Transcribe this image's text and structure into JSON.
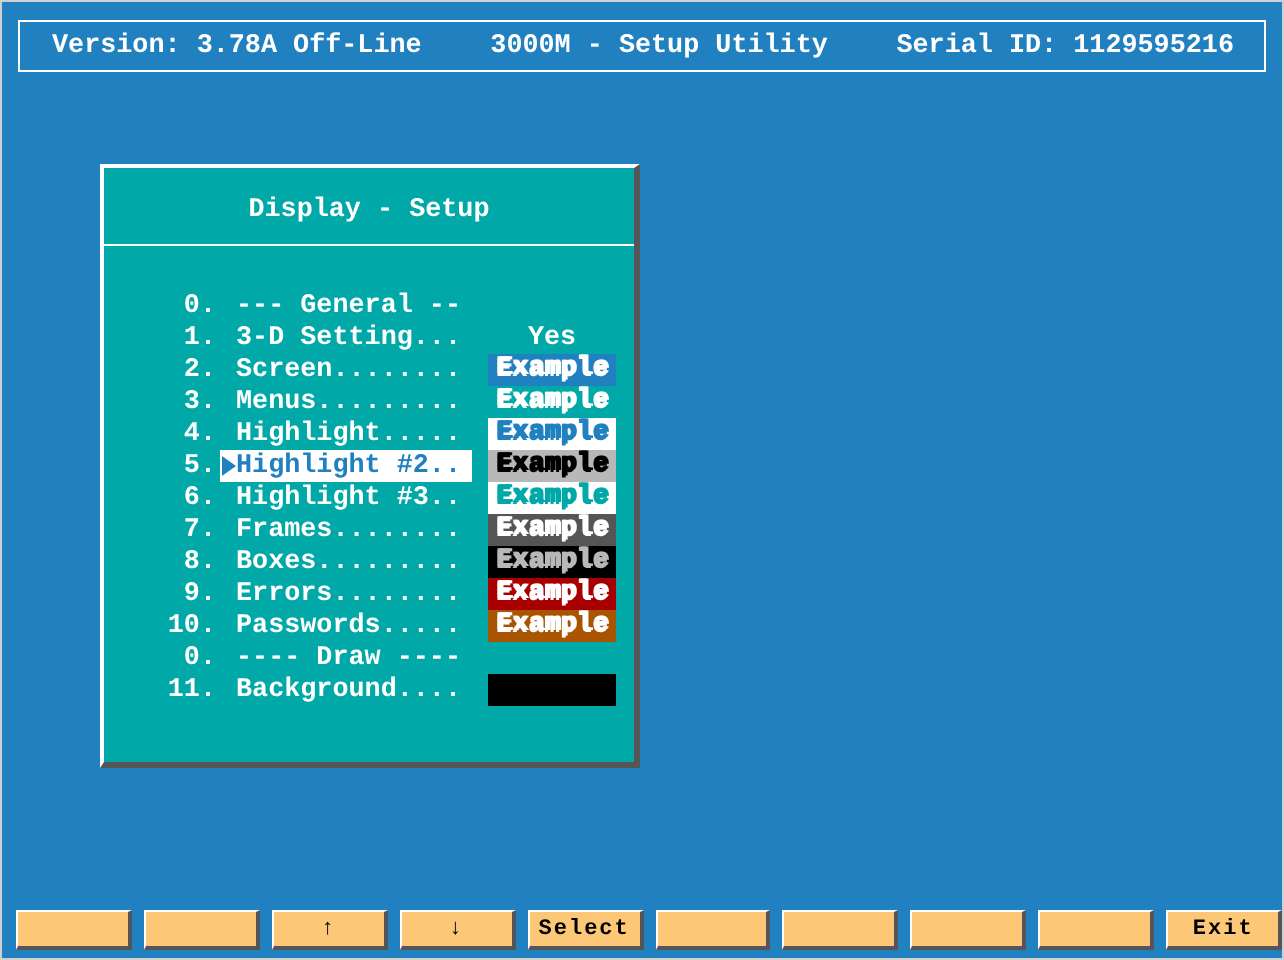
{
  "header": {
    "version": "Version: 3.78A Off-Line",
    "title": "3000M - Setup Utility",
    "serial": "Serial ID: 1129595216"
  },
  "dialog": {
    "title": "Display - Setup",
    "items": [
      {
        "number": "0.",
        "label": "--- General --",
        "kind": "heading",
        "selected": false
      },
      {
        "number": "1.",
        "label": "3-D Setting...",
        "kind": "value",
        "value": "Yes",
        "selected": false
      },
      {
        "number": "2.",
        "label": "Screen........",
        "kind": "example",
        "value": "Example",
        "color": "#2080c0",
        "ink": {
          "color": "#ffffff"
        },
        "selected": false
      },
      {
        "number": "3.",
        "label": "Menus.........",
        "kind": "example",
        "value": "Example",
        "color": "#00a8a8",
        "ink": {
          "color": "#ffffff"
        },
        "selected": false
      },
      {
        "number": "4.",
        "label": "Highlight.....",
        "kind": "example",
        "value": "Example",
        "color": "#ffffff",
        "ink": {
          "color": "#2080c0"
        },
        "selected": false
      },
      {
        "number": "5.",
        "label": "Highlight #2..",
        "kind": "example",
        "value": "Example",
        "color": "#b8b8b8",
        "ink": {
          "color": "#000000"
        },
        "selected": true
      },
      {
        "number": "6.",
        "label": "Highlight #3..",
        "kind": "example",
        "value": "Example",
        "color": "#ffffff",
        "ink": {
          "color": "#00a8a8"
        },
        "selected": false
      },
      {
        "number": "7.",
        "label": "Frames........",
        "kind": "example",
        "value": "Example",
        "color": "#555555",
        "ink": {
          "color": "#ffffff"
        },
        "selected": false
      },
      {
        "number": "8.",
        "label": "Boxes.........",
        "kind": "example",
        "value": "Example",
        "color": "#000000",
        "ink": {
          "color": "#b8b8b8"
        },
        "selected": false
      },
      {
        "number": "9.",
        "label": "Errors........",
        "kind": "example",
        "value": "Example",
        "color": "#a80000",
        "ink": {
          "color": "#ffffff"
        },
        "selected": false
      },
      {
        "number": "10.",
        "label": "Passwords.....",
        "kind": "example",
        "value": "Example",
        "color": "#a85400",
        "ink": {
          "color": "#ffffff"
        },
        "selected": false
      },
      {
        "number": "0.",
        "label": "---- Draw ----",
        "kind": "heading",
        "selected": false
      },
      {
        "number": "11.",
        "label": "Background....",
        "kind": "swatch",
        "color": "#000000",
        "selected": false
      }
    ]
  },
  "keys": [
    {
      "kind": "blank"
    },
    {
      "kind": "blank"
    },
    {
      "kind": "labeled",
      "label": "↑"
    },
    {
      "kind": "labeled",
      "label": "↓"
    },
    {
      "kind": "labeled",
      "label": "Select"
    },
    {
      "kind": "blank"
    },
    {
      "kind": "blank"
    },
    {
      "kind": "blank"
    },
    {
      "kind": "blank"
    },
    {
      "kind": "labeled",
      "label": "Exit"
    }
  ]
}
